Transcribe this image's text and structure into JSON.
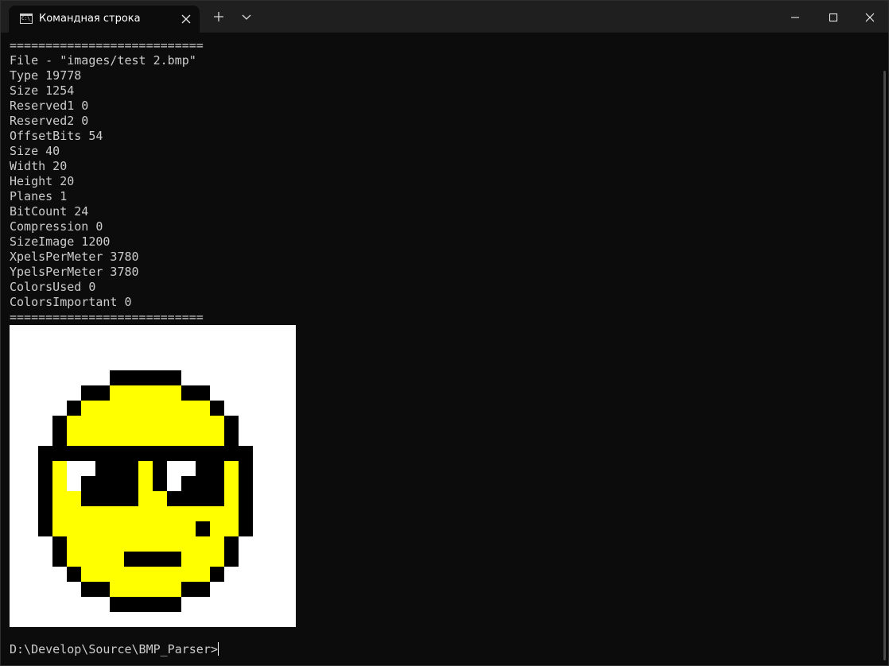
{
  "window": {
    "tab_title": "Командная строка",
    "tab_icon": "cmd-icon"
  },
  "console_lines": [
    "===========================",
    "File - \"images/test 2.bmp\"",
    "Type 19778",
    "Size 1254",
    "Reserved1 0",
    "Reserved2 0",
    "OffsetBits 54",
    "Size 40",
    "Width 20",
    "Height 20",
    "Planes 1",
    "BitCount 24",
    "Compression 0",
    "SizeImage 1200",
    "XpelsPerMeter 3780",
    "YpelsPerMeter 3780",
    "ColorsUsed 0",
    "ColorsImportant 0",
    "==========================="
  ],
  "bitmap": {
    "colors": {
      "W": "#ffffff",
      "B": "#000000",
      "Y": "#ffff00"
    },
    "rows": [
      "WWWWWWWWWWWWWWWWWWWW",
      "WWWWWWWWWWWWWWWWWWWW",
      "WWWWWWWWWWWWWWWWWWWW",
      "WWWWWWWBBBBBWWWWWWWW",
      "WWWWWBBYYYYYBBWWWWWW",
      "WWWWBYYYYYYYYYBWWWWW",
      "WWWBYYYYYYYYYYYBWWWW",
      "WWWBYYYYYYYYYYYBWWWW",
      "WWBBBBBBBBBBBBBBBWWW",
      "WWBYWWBBBYBWWBBYBWWW",
      "WWBYWBBBBYBWBBBYBWWW",
      "WWBYYBBBBYYBBBBYBWWW",
      "WWBYYYYYYYYYYYYYBWWW",
      "WWBYYYYYYYYYYBYYBWWW",
      "WWWBYYYYYYYYYYYBWWWW",
      "WWWBYYYYBBBBYYYBWWWW",
      "WWWWBYYYYYYYYYBWWWWW",
      "WWWWWBBYYYYYBBWWWWWW",
      "WWWWWWWBBBBBWWWWWWWW",
      "WWWWWWWWWWWWWWWWWWWW"
    ]
  },
  "prompt": "D:\\Develop\\Source\\BMP_Parser>"
}
